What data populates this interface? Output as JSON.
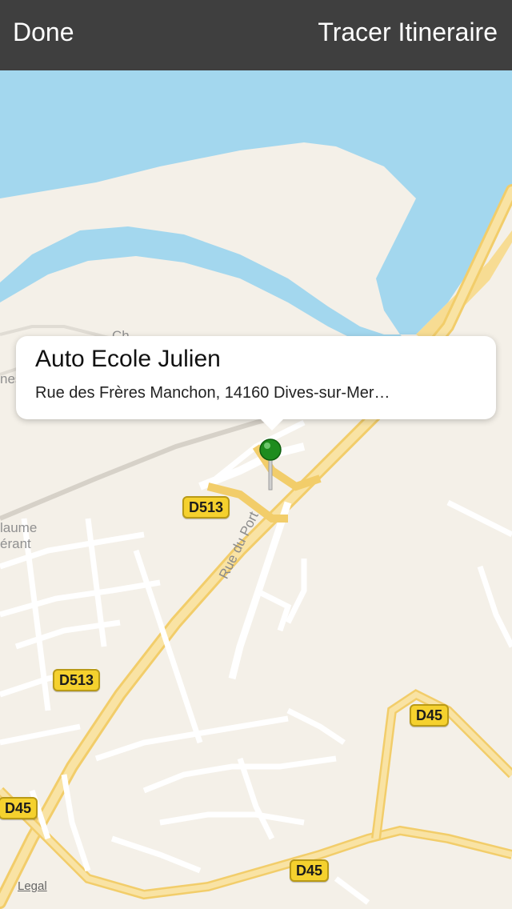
{
  "navbar": {
    "done_label": "Done",
    "route_label": "Tracer Itineraire",
    "background": "#3f3f3f"
  },
  "callout": {
    "title": "Auto Ecole Julien",
    "address": "Rue des Frères Manchon, 14160 Dives-sur-Mer…"
  },
  "map": {
    "water_color": "#a3d7ee",
    "land_color": "#f4f0e8",
    "road_color": "#f7d98a",
    "pin_color": "#1e8c1e",
    "road_shields": [
      {
        "id": "d513-upper",
        "label": "D513"
      },
      {
        "id": "d513-lower",
        "label": "D513"
      },
      {
        "id": "d45-right",
        "label": "D45"
      },
      {
        "id": "d45-left",
        "label": "D45"
      },
      {
        "id": "d45-bottom",
        "label": "D45"
      }
    ],
    "street_name": "Rue du Port",
    "place_fragments": [
      "laume",
      "érant",
      "nes",
      "Ch"
    ],
    "legal_label": "Legal"
  }
}
